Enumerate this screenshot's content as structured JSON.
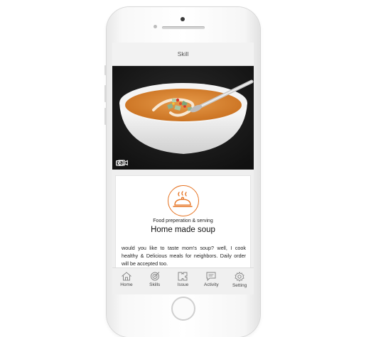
{
  "header": {
    "title": "Skill"
  },
  "hero": {
    "photo_count": "5",
    "video_count": "1"
  },
  "card": {
    "category": "Food preperation & serving",
    "title": "Home made soup",
    "description": "would you like to taste mom's soup? well, I cook healthy & Delicious meals for neighbors. Daily order will be accepted too."
  },
  "tabbar": {
    "items": [
      {
        "label": "Home",
        "icon": "home-icon"
      },
      {
        "label": "Skills",
        "icon": "target-icon"
      },
      {
        "label": "Issue",
        "icon": "puzzle-icon"
      },
      {
        "label": "Activity",
        "icon": "chat-icon"
      },
      {
        "label": "Setting",
        "icon": "gear-icon"
      }
    ]
  },
  "colors": {
    "accent": "#e5711f",
    "soup": "#d98a3c"
  }
}
